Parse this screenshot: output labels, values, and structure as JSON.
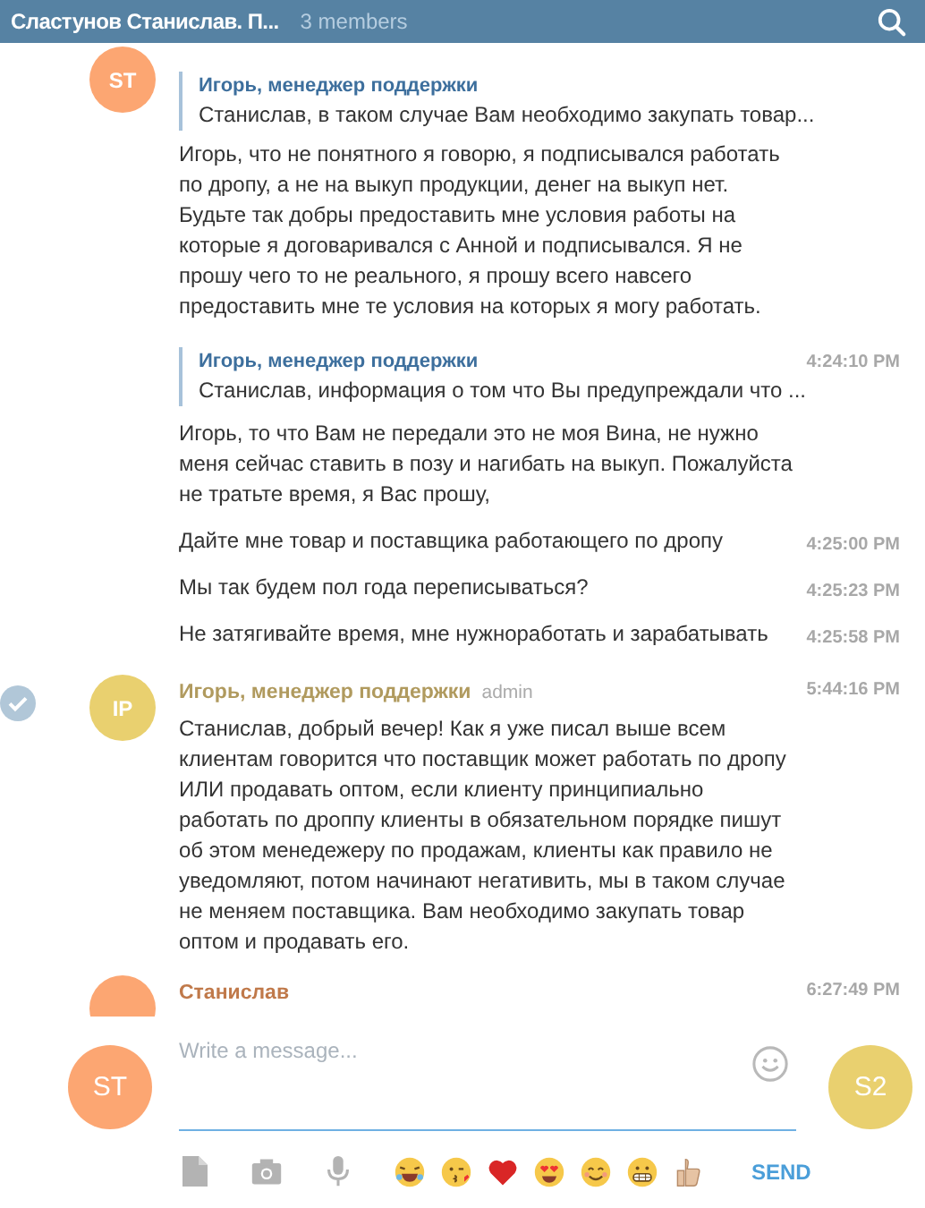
{
  "header": {
    "title": "Сластунов Станислав. П...",
    "subtitle": "3 members"
  },
  "messages": [
    {
      "avatar": {
        "initials": "ST",
        "color": "#fca672"
      },
      "reply": {
        "author": "Игорь, менеджер поддержки",
        "text": "Станислав, в таком случае Вам необходимо закупать товар..."
      },
      "text": "Игорь, что не понятного я говорю, я подписывался работать по дропу, а не на выкуп продукции, денег на выкуп нет. Будьте так добры предоставить мне условия работы на которые я договаривался с Анной и подписывался. Я не прошу чего то не реального, я прошу всего навсего предоставить мне те условия на которых я могу работать.",
      "selected": false
    },
    {
      "reply": {
        "author": "Игорь, менеджер поддержки",
        "text": "Станислав, информация о том что Вы предупреждали что ..."
      },
      "time": "4:24:10 PM",
      "text": "Игорь, то что Вам не передали это не моя Вина, не нужно меня сейчас ставить в позу и нагибать на выкуп. Пожалуйста не тратьте время, я Вас прошу,",
      "selected": false
    },
    {
      "time": "4:25:00 PM",
      "text": "Дайте мне товар и поставщика работающего по дропу",
      "selected": false
    },
    {
      "time": "4:25:23 PM",
      "text": "Мы так будем пол года переписываться?",
      "selected": false
    },
    {
      "time": "4:25:58 PM",
      "text": "Не затягивайте время, мне нужноработать и зарабатывать",
      "selected": false
    },
    {
      "avatar": {
        "initials": "IP",
        "color": "#e9d06f"
      },
      "author": {
        "name": "Игорь, менеджер поддержки",
        "color": "#b09a5e"
      },
      "badge": "admin",
      "time": "5:44:16 PM",
      "text": "Станислав, добрый вечер! Как я уже писал выше всем клиентам говорится что поставщик может работать по дропу ИЛИ продавать оптом, если клиенту принципиально работать по дроппу клиенты в обязательном порядке пишут об этом менедежеру по продажам, клиенты как правило не уведомляют, потом начинают негативить, мы в таком случае не меняем поставщика. Вам необходимо закупать товар оптом и продавать его.",
      "selected": true
    },
    {
      "avatar": {
        "color": "#fca672"
      },
      "author": {
        "name": "Станислав",
        "color": "#c0794a"
      },
      "time": "6:27:49 PM",
      "selected": false
    }
  ],
  "compose": {
    "own_avatar": {
      "initials": "ST",
      "color": "#fca672"
    },
    "placeholder": "Write a message...",
    "peer_avatar": {
      "initials": "S2",
      "color": "#e9d06f"
    },
    "tools": [
      {
        "kind": "file"
      },
      {
        "kind": "camera"
      },
      {
        "kind": "mic"
      }
    ],
    "emojis": [
      {
        "kind": "laughing"
      },
      {
        "kind": "kiss"
      },
      {
        "kind": "heart"
      },
      {
        "kind": "heart-eyes"
      },
      {
        "kind": "smile"
      },
      {
        "kind": "grin"
      },
      {
        "kind": "thumbs-up"
      }
    ],
    "send": "SEND"
  }
}
